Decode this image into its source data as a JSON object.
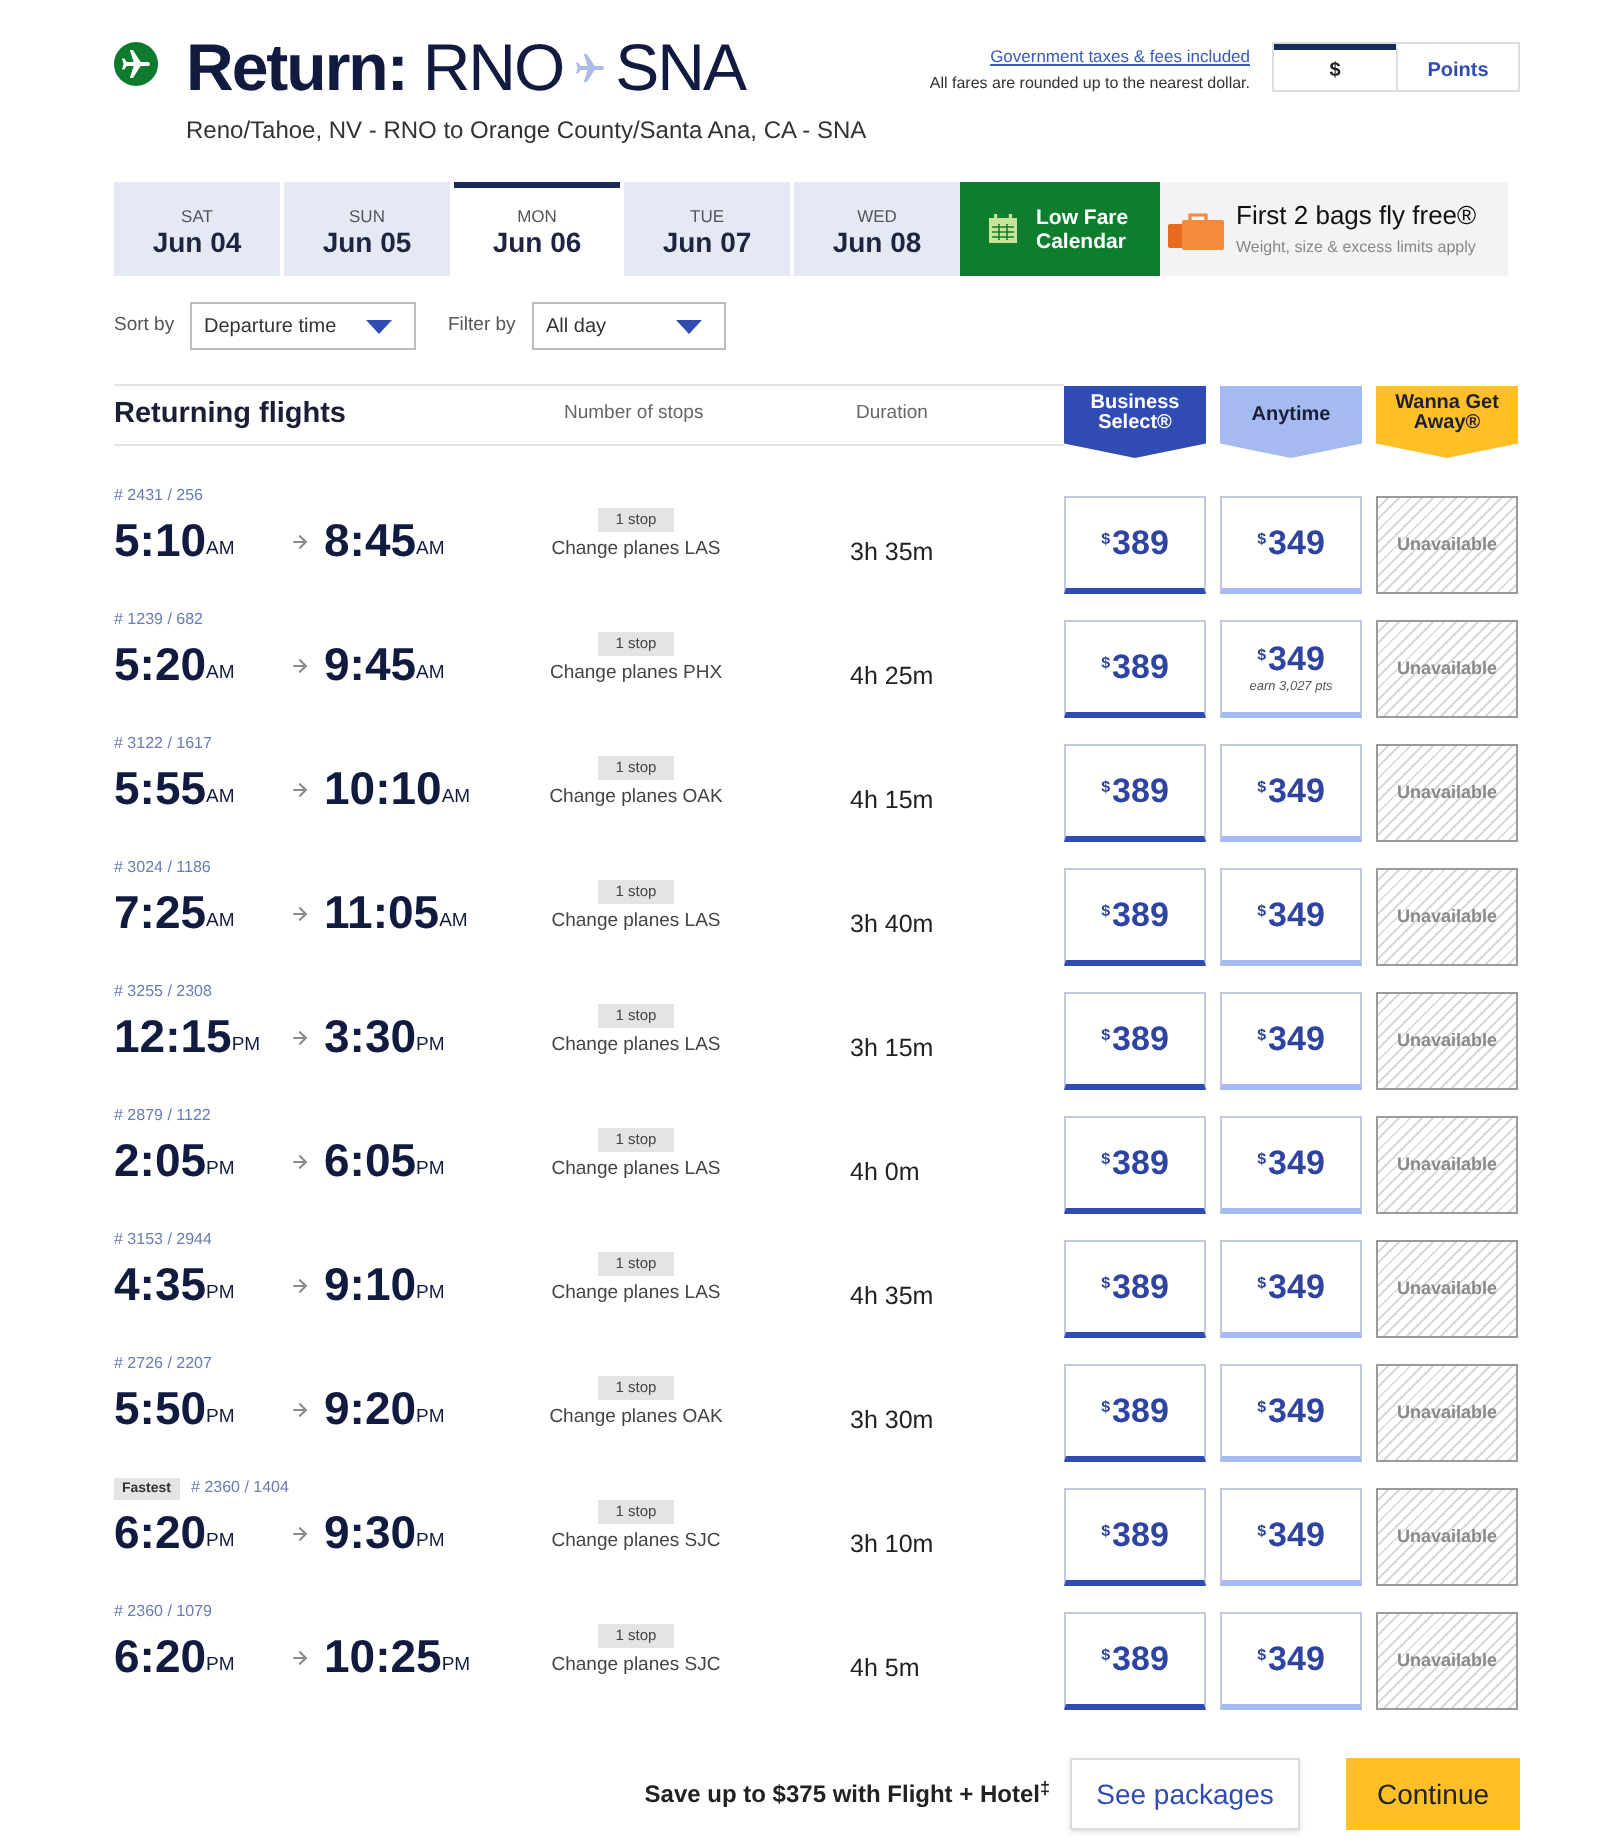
{
  "header": {
    "title": "Return:",
    "origin": "RNO",
    "destination": "SNA",
    "route": "Reno/Tahoe, NV - RNO to Orange County/Santa Ana, CA - SNA"
  },
  "fare_notice": {
    "link": "Government taxes & fees included",
    "note": "All fares are rounded up to the nearest dollar."
  },
  "currency_toggle": [
    {
      "label": "$",
      "selected": true
    },
    {
      "label": "Points",
      "selected": false
    }
  ],
  "date_tabs": [
    {
      "day": "SAT",
      "date": "Jun 04",
      "selected": false
    },
    {
      "day": "SUN",
      "date": "Jun 05",
      "selected": false
    },
    {
      "day": "MON",
      "date": "Jun 06",
      "selected": true
    },
    {
      "day": "TUE",
      "date": "Jun 07",
      "selected": false
    },
    {
      "day": "WED",
      "date": "Jun 08",
      "selected": false
    }
  ],
  "low_fare_calendar": "Low Fare Calendar",
  "bags_promo": {
    "title": "First 2 bags fly free®",
    "subtitle": "Weight, size & excess limits apply"
  },
  "sort": {
    "label": "Sort by",
    "value": "Departure time"
  },
  "filter": {
    "label": "Filter by",
    "value": "All day"
  },
  "table": {
    "title": "Returning flights",
    "columns": [
      "Number of stops",
      "Duration"
    ],
    "fare_classes": [
      {
        "label": "Business Select®",
        "color": "#304cb2"
      },
      {
        "label": "Anytime",
        "color": "#a4baf0"
      },
      {
        "label": "Wanna Get Away®",
        "color": "#ffbf27"
      }
    ],
    "rows": [
      {
        "flight": "# 2431 / 256",
        "depart": {
          "time": "5:10",
          "period": "AM"
        },
        "arrive": {
          "time": "8:45",
          "period": "AM"
        },
        "stops": "1 stop",
        "connection": "Change planes LAS",
        "duration": "3h 35m",
        "fares": [
          {
            "kind": "price",
            "currency": "$",
            "amount": "389"
          },
          {
            "kind": "price",
            "currency": "$",
            "amount": "349"
          },
          {
            "kind": "unavailable",
            "label": "Unavailable"
          }
        ]
      },
      {
        "flight": "# 1239 / 682",
        "depart": {
          "time": "5:20",
          "period": "AM"
        },
        "arrive": {
          "time": "9:45",
          "period": "AM"
        },
        "stops": "1 stop",
        "connection": "Change planes PHX",
        "duration": "4h 25m",
        "fares": [
          {
            "kind": "price",
            "currency": "$",
            "amount": "389"
          },
          {
            "kind": "price",
            "currency": "$",
            "amount": "349",
            "note": "earn 3,027 pts"
          },
          {
            "kind": "unavailable",
            "label": "Unavailable"
          }
        ]
      },
      {
        "flight": "# 3122 / 1617",
        "depart": {
          "time": "5:55",
          "period": "AM"
        },
        "arrive": {
          "time": "10:10",
          "period": "AM"
        },
        "stops": "1 stop",
        "connection": "Change planes OAK",
        "duration": "4h 15m",
        "fares": [
          {
            "kind": "price",
            "currency": "$",
            "amount": "389"
          },
          {
            "kind": "price",
            "currency": "$",
            "amount": "349"
          },
          {
            "kind": "unavailable",
            "label": "Unavailable"
          }
        ]
      },
      {
        "flight": "# 3024 / 1186",
        "depart": {
          "time": "7:25",
          "period": "AM"
        },
        "arrive": {
          "time": "11:05",
          "period": "AM"
        },
        "stops": "1 stop",
        "connection": "Change planes LAS",
        "duration": "3h 40m",
        "fares": [
          {
            "kind": "price",
            "currency": "$",
            "amount": "389"
          },
          {
            "kind": "price",
            "currency": "$",
            "amount": "349"
          },
          {
            "kind": "unavailable",
            "label": "Unavailable"
          }
        ]
      },
      {
        "flight": "# 3255 / 2308",
        "depart": {
          "time": "12:15",
          "period": "PM"
        },
        "arrive": {
          "time": "3:30",
          "period": "PM"
        },
        "stops": "1 stop",
        "connection": "Change planes LAS",
        "duration": "3h 15m",
        "fares": [
          {
            "kind": "price",
            "currency": "$",
            "amount": "389"
          },
          {
            "kind": "price",
            "currency": "$",
            "amount": "349"
          },
          {
            "kind": "unavailable",
            "label": "Unavailable"
          }
        ]
      },
      {
        "flight": "# 2879 / 1122",
        "depart": {
          "time": "2:05",
          "period": "PM"
        },
        "arrive": {
          "time": "6:05",
          "period": "PM"
        },
        "stops": "1 stop",
        "connection": "Change planes LAS",
        "duration": "4h 0m",
        "fares": [
          {
            "kind": "price",
            "currency": "$",
            "amount": "389"
          },
          {
            "kind": "price",
            "currency": "$",
            "amount": "349"
          },
          {
            "kind": "unavailable",
            "label": "Unavailable"
          }
        ]
      },
      {
        "flight": "# 3153 / 2944",
        "depart": {
          "time": "4:35",
          "period": "PM"
        },
        "arrive": {
          "time": "9:10",
          "period": "PM"
        },
        "stops": "1 stop",
        "connection": "Change planes LAS",
        "duration": "4h 35m",
        "fares": [
          {
            "kind": "price",
            "currency": "$",
            "amount": "389"
          },
          {
            "kind": "price",
            "currency": "$",
            "amount": "349"
          },
          {
            "kind": "unavailable",
            "label": "Unavailable"
          }
        ]
      },
      {
        "flight": "# 2726 / 2207",
        "depart": {
          "time": "5:50",
          "period": "PM"
        },
        "arrive": {
          "time": "9:20",
          "period": "PM"
        },
        "stops": "1 stop",
        "connection": "Change planes OAK",
        "duration": "3h 30m",
        "fares": [
          {
            "kind": "price",
            "currency": "$",
            "amount": "389"
          },
          {
            "kind": "price",
            "currency": "$",
            "amount": "349"
          },
          {
            "kind": "unavailable",
            "label": "Unavailable"
          }
        ]
      },
      {
        "badge": "Fastest",
        "flight": "# 2360 / 1404",
        "depart": {
          "time": "6:20",
          "period": "PM"
        },
        "arrive": {
          "time": "9:30",
          "period": "PM"
        },
        "stops": "1 stop",
        "connection": "Change planes SJC",
        "duration": "3h 10m",
        "fares": [
          {
            "kind": "price",
            "currency": "$",
            "amount": "389"
          },
          {
            "kind": "price",
            "currency": "$",
            "amount": "349"
          },
          {
            "kind": "unavailable",
            "label": "Unavailable"
          }
        ]
      },
      {
        "flight": "# 2360 / 1079",
        "depart": {
          "time": "6:20",
          "period": "PM"
        },
        "arrive": {
          "time": "10:25",
          "period": "PM"
        },
        "stops": "1 stop",
        "connection": "Change planes SJC",
        "duration": "4h 5m",
        "fares": [
          {
            "kind": "price",
            "currency": "$",
            "amount": "389"
          },
          {
            "kind": "price",
            "currency": "$",
            "amount": "349"
          },
          {
            "kind": "unavailable",
            "label": "Unavailable"
          }
        ]
      }
    ]
  },
  "footer": {
    "promo": "Save up to $375 with Flight + Hotel$^{‡}$",
    "buttons": [
      {
        "label": "See packages",
        "kind": "secondary"
      },
      {
        "label": "Continue",
        "kind": "primary"
      }
    ]
  }
}
